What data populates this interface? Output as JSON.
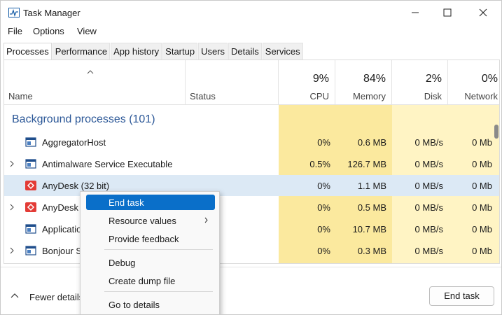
{
  "window": {
    "title": "Task Manager"
  },
  "menu": [
    "File",
    "Options",
    "View"
  ],
  "tabs": [
    "Processes",
    "Performance",
    "App history",
    "Startup",
    "Users",
    "Details",
    "Services"
  ],
  "columns": {
    "name": "Name",
    "status": "Status",
    "cpu": {
      "percent": "9%",
      "label": "CPU"
    },
    "memory": {
      "percent": "84%",
      "label": "Memory"
    },
    "disk": {
      "percent": "2%",
      "label": "Disk"
    },
    "network": {
      "percent": "0%",
      "label": "Network"
    }
  },
  "group": {
    "label": "Background processes (101)"
  },
  "rows": [
    {
      "name": "AggregatorHost",
      "cpu": "0%",
      "memory": "0.6 MB",
      "disk": "0 MB/s",
      "network": "0 Mb",
      "expandable": false,
      "icon": "window-icon"
    },
    {
      "name": "Antimalware Service Executable",
      "cpu": "0.5%",
      "memory": "126.7 MB",
      "disk": "0 MB/s",
      "network": "0 Mb",
      "expandable": true,
      "icon": "window-icon"
    },
    {
      "name": "AnyDesk (32 bit)",
      "cpu": "0%",
      "memory": "1.1 MB",
      "disk": "0 MB/s",
      "network": "0 Mb",
      "expandable": false,
      "icon": "anydesk-icon",
      "selected": true
    },
    {
      "name": "AnyDesk",
      "cpu": "0%",
      "memory": "0.5 MB",
      "disk": "0 MB/s",
      "network": "0 Mb",
      "expandable": true,
      "icon": "anydesk-icon"
    },
    {
      "name": "Applicatio",
      "cpu": "0%",
      "memory": "10.7 MB",
      "disk": "0 MB/s",
      "network": "0 Mb",
      "expandable": false,
      "icon": "window-icon"
    },
    {
      "name": "Bonjour S",
      "cpu": "0%",
      "memory": "0.3 MB",
      "disk": "0 MB/s",
      "network": "0 Mb",
      "expandable": true,
      "icon": "window-icon"
    }
  ],
  "context_menu": {
    "items": [
      "End task",
      "Resource values",
      "Provide feedback",
      "Debug",
      "Create dump file",
      "Go to details"
    ],
    "highlighted": "End task"
  },
  "bottom": {
    "fewer_details": "Fewer details",
    "end_task": "End task"
  },
  "colors": {
    "accent": "#0a6fc9",
    "group_text": "#2b5797",
    "selection": "#dce9f5",
    "heat_light": "#fff4c4",
    "heat_deep": "#fbe99e",
    "anydesk_red": "#e33b36"
  }
}
